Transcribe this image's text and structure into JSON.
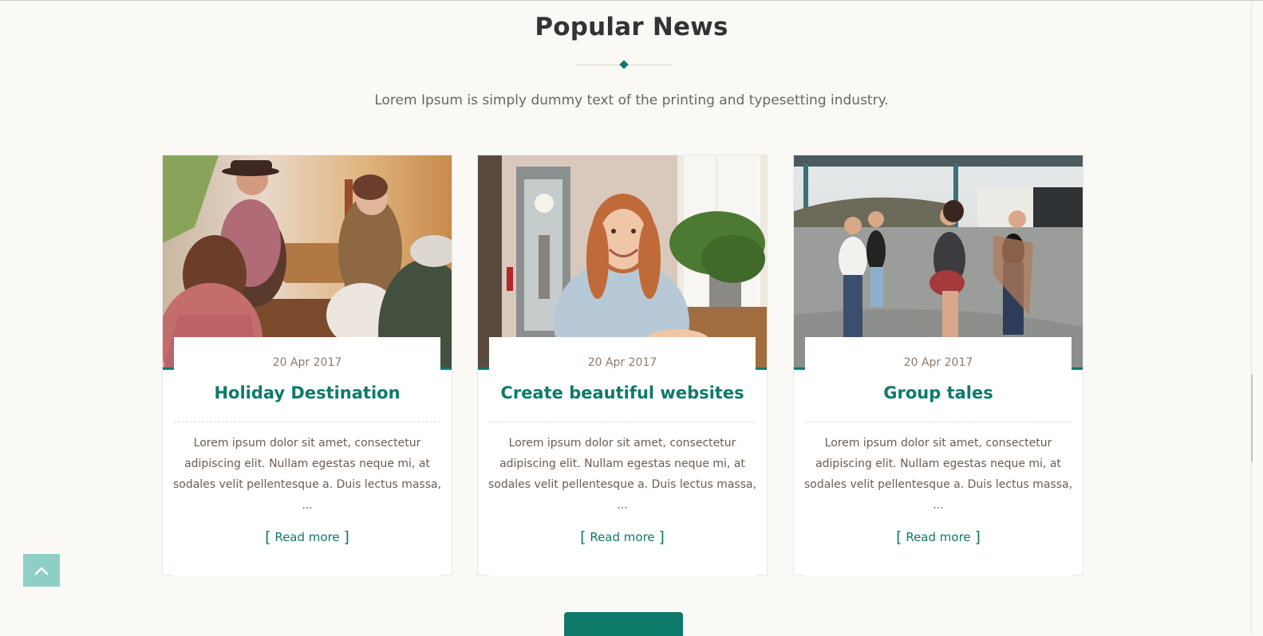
{
  "section": {
    "title": "Popular News",
    "subtitle": "Lorem Ipsum is simply dummy text of the printing and typesetting industry."
  },
  "cards": [
    {
      "date": "20 Apr 2017",
      "title": "Holiday Destination",
      "excerpt": "Lorem ipsum dolor sit amet, consectetur adipiscing elit. Nullam egestas neque mi, at sodales velit pellentesque a. Duis lectus massa, ...",
      "read_more": "Read more",
      "image": "group-camping-photo"
    },
    {
      "date": "20 Apr 2017",
      "title": "Create beautiful websites",
      "excerpt": "Lorem ipsum dolor sit amet, consectetur adipiscing elit. Nullam egestas neque mi, at sodales velit pellentesque a. Duis lectus massa, ...",
      "read_more": "Read more",
      "image": "smiling-woman-photo"
    },
    {
      "date": "20 Apr 2017",
      "title": "Group tales",
      "excerpt": "Lorem ipsum dolor sit amet, consectetur adipiscing elit. Nullam egestas neque mi, at sodales velit pellentesque a. Duis lectus massa, ...",
      "read_more": "Read more",
      "image": "friends-walking-photo"
    }
  ],
  "controls": {
    "back_to_top_icon": "chevron-up-icon"
  },
  "colors": {
    "accent": "#0e7a69",
    "background": "#fbf9f6",
    "back_to_top": "#8dcfc5"
  }
}
